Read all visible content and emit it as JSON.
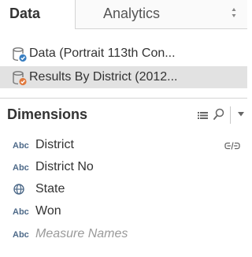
{
  "tabs": {
    "data_label": "Data",
    "analytics_label": "Analytics"
  },
  "data_sources": [
    {
      "label": "Data (Portrait 113th Con...",
      "selected": false
    },
    {
      "label": "Results By District (2012...",
      "selected": true
    }
  ],
  "dimensions": {
    "title": "Dimensions",
    "fields": [
      {
        "type_label": "Abc",
        "name": "District"
      },
      {
        "type_label": "Abc",
        "name": "District No"
      },
      {
        "type": "geographic",
        "name": "State"
      },
      {
        "type_label": "Abc",
        "name": "Won"
      },
      {
        "type_label": "Abc",
        "name": "Measure Names"
      }
    ]
  },
  "colors": {
    "db_icon_blue": "#3a7fc1",
    "db_icon_orange": "#e07a3f",
    "type_label": "#4e6a89",
    "selected_row": "#e2e2e2"
  }
}
